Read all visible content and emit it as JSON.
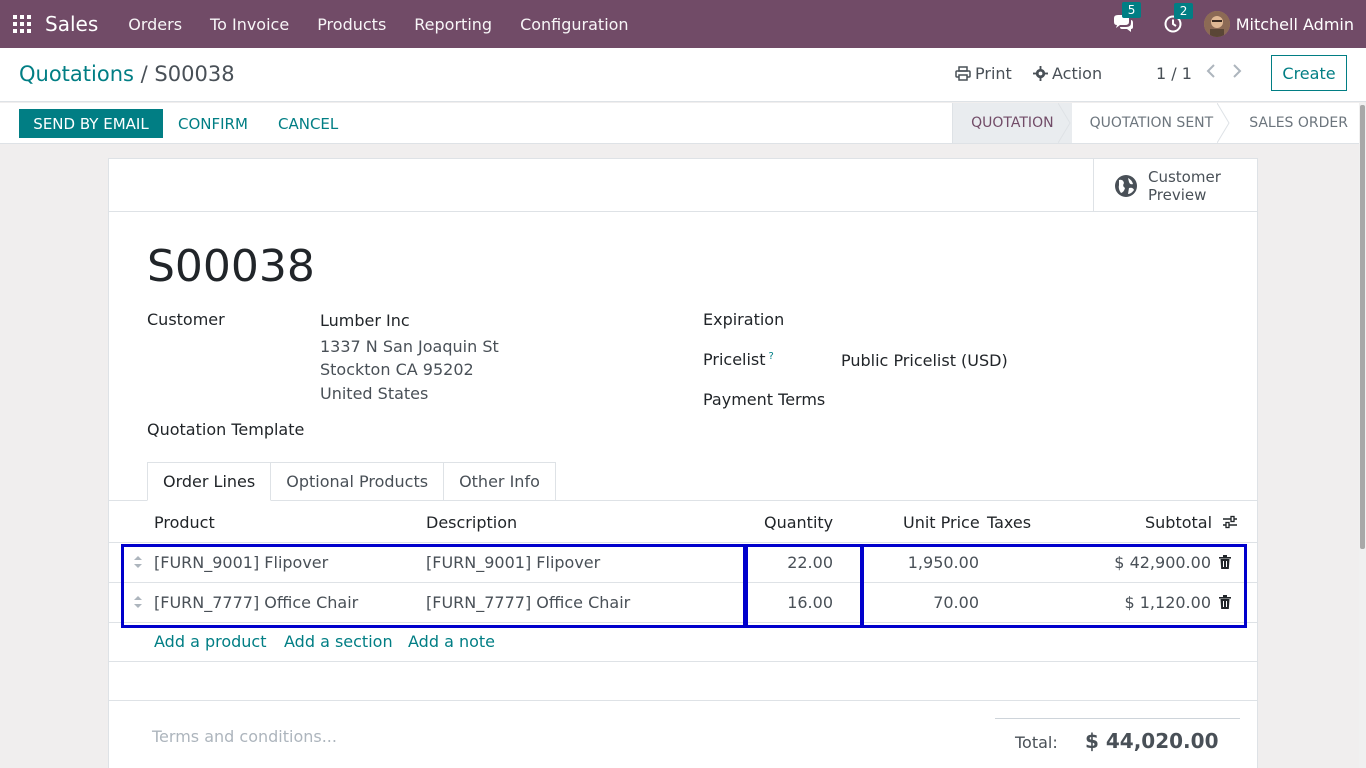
{
  "navbar": {
    "app_name": "Sales",
    "menu": [
      "Orders",
      "To Invoice",
      "Products",
      "Reporting",
      "Configuration"
    ],
    "messages_count": "5",
    "activities_count": "2",
    "user_name": "Mitchell Admin",
    "bg_color": "#714b67"
  },
  "control_panel": {
    "breadcrumb_parent": "Quotations",
    "breadcrumb_sep": "/",
    "breadcrumb_current": "S00038",
    "print_label": "Print",
    "action_label": "Action",
    "pager": "1 / 1",
    "create_label": "Create"
  },
  "statusbar": {
    "send_email": "SEND BY EMAIL",
    "confirm": "CONFIRM",
    "cancel": "CANCEL",
    "stages": [
      "QUOTATION",
      "QUOTATION SENT",
      "SALES ORDER"
    ],
    "active_stage": "QUOTATION"
  },
  "sheet": {
    "customer_preview": "Customer Preview",
    "title": "S00038",
    "customer_label": "Customer",
    "customer_name": "Lumber Inc",
    "address_lines": [
      "1337 N San Joaquin St",
      "Stockton CA 95202",
      "United States"
    ],
    "template_label": "Quotation Template",
    "expiration_label": "Expiration",
    "pricelist_label": "Pricelist",
    "pricelist_help": "?",
    "pricelist_value": "Public Pricelist (USD)",
    "payment_terms_label": "Payment Terms",
    "tabs": [
      "Order Lines",
      "Optional Products",
      "Other Info"
    ],
    "columns": {
      "product": "Product",
      "description": "Description",
      "quantity": "Quantity",
      "unit_price": "Unit Price",
      "taxes": "Taxes",
      "subtotal": "Subtotal"
    },
    "lines": [
      {
        "product": "[FURN_9001] Flipover",
        "description": "[FURN_9001] Flipover",
        "quantity": "22.00",
        "unit_price": "1,950.00",
        "taxes": "",
        "subtotal": "$ 42,900.00"
      },
      {
        "product": "[FURN_7777] Office Chair",
        "description": "[FURN_7777] Office Chair",
        "quantity": "16.00",
        "unit_price": "70.00",
        "taxes": "",
        "subtotal": "$ 1,120.00"
      }
    ],
    "add_product": "Add a product",
    "add_section": "Add a section",
    "add_note": "Add a note",
    "terms_placeholder": "Terms and conditions...",
    "total_label": "Total:",
    "total_value": "$ 44,020.00"
  },
  "colors": {
    "primary": "#714b67",
    "accent": "#017e84",
    "highlight": "#0000cc"
  }
}
